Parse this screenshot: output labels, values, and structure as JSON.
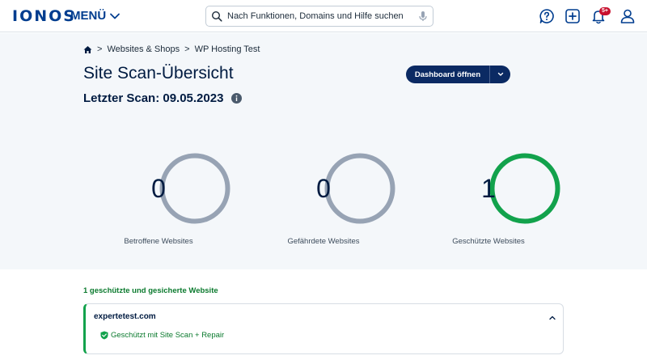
{
  "header": {
    "logo": "IONOS",
    "menu_label": "MENÜ",
    "search_placeholder": "Nach Funktionen, Domains und Hilfe suchen",
    "notification_badge": "5+",
    "icons": [
      "help-icon",
      "add-icon",
      "bell-icon",
      "user-icon",
      "search-icon",
      "microphone-icon"
    ]
  },
  "breadcrumb": {
    "home_icon": "home-icon",
    "items": [
      "Websites & Shops",
      "WP Hosting Test"
    ],
    "separator": ">"
  },
  "page": {
    "title": "Site Scan-Übersicht",
    "last_scan": "Letzter Scan: 09.05.2023",
    "dashboard_button": "Dashboard öffnen"
  },
  "stats": [
    {
      "value": "0",
      "label": "Betroffene Websites",
      "color": "#97a3b4"
    },
    {
      "value": "0",
      "label": "Gefährdete Websites",
      "color": "#97a3b4"
    },
    {
      "value": "1",
      "label": "Geschützte Websites",
      "color": "#12a24c"
    }
  ],
  "protected_section": {
    "title": "1 geschützte und gesicherte Website",
    "site": {
      "domain": "expertetest.com",
      "status": "Geschützt mit Site Scan + Repair"
    }
  },
  "colors": {
    "brand": "#003d8f",
    "button": "#0b2a63",
    "success": "#12a24c",
    "neutral_ring": "#97a3b4",
    "badge": "#c8102e"
  }
}
